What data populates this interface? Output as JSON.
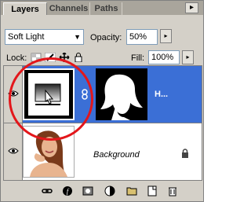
{
  "tabs": [
    "Layers",
    "Channels",
    "Paths"
  ],
  "menu_icon": "triangle-menu-icon",
  "blend_mode": "Soft Light",
  "opacity_label": "Opacity:",
  "opacity_value": "50%",
  "lock_label": "Lock:",
  "fill_label": "Fill:",
  "fill_value": "100%",
  "layers": [
    {
      "name": "H...",
      "selected": true,
      "visible": true,
      "type": "adjustment-with-mask"
    },
    {
      "name": "Background",
      "selected": false,
      "visible": true,
      "type": "image",
      "locked": true
    }
  ],
  "bottom_icons": [
    "link-icon",
    "layer-style-icon",
    "add-mask-icon",
    "adjustment-layer-icon",
    "new-group-icon",
    "new-layer-icon",
    "trash-icon"
  ],
  "colors": {
    "selection": "#3b6fd6",
    "panel": "#d4d0c8",
    "highlight_circle": "#e3171b"
  }
}
